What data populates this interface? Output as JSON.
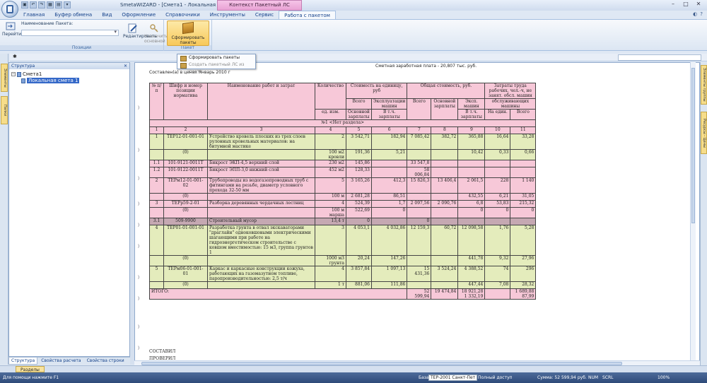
{
  "titlebar": {
    "title": "SmetaWIZARD - [Смета1 - Локальная смета 1]",
    "context_tab": "Контекст Пакетный ЛС",
    "qat": [
      "▣",
      "↶",
      "↷",
      "▦",
      "▤",
      "▾"
    ]
  },
  "tabs": [
    "Главная",
    "Буфер обмена",
    "Вид",
    "Оформление",
    "Справочники",
    "Инструменты",
    "Сервис",
    "Работа с пакетом"
  ],
  "ribbon": {
    "group_positions": "Позиции",
    "group_batch": "Пакет",
    "batch_name_label": "Наименование Пакета:",
    "goto": "Перейти",
    "edit": "Редактировать",
    "assign_main": "Назначить основной",
    "form_packages": "Сформировать пакеты"
  },
  "dropdown": {
    "item1": "Сформировать пакеты",
    "item2": "Создать пакетный ЛС из сметы"
  },
  "panel": {
    "header": "Структура",
    "tree_root": "Смета1",
    "tree_child": "Локальная смета 1",
    "tabs": [
      "Структура",
      "Свойства расчета",
      "Свойства строки"
    ]
  },
  "left_strip": [
    "Элементы",
    "Папки"
  ],
  "right_strip": [
    "Элементы группы",
    "Ресурсы - Цены"
  ],
  "doc": {
    "top_right": "Сметная заработная плата -           20,807 тыс. руб.",
    "top_left": "Составлен(а) в ценах Январь 2010 г",
    "headers": {
      "num": "№ п/п",
      "code": "Шифр и номер позиции норматива",
      "name": "Наименование работ и затрат",
      "qty": "Количество",
      "unit": "ед. изм.",
      "unit_cost": "Стоимость на единицу, руб",
      "total_cost": "Общая стоимость, руб.",
      "labor": "Затраты труда рабочих, чел.-ч, не занят. обсл. машин",
      "total": "Всего",
      "machines": "Эксплуатации машин",
      "base_salary": "Основной зарплаты",
      "incl_salary": "В т.ч. зарплаты",
      "mach": "Эксп. машин",
      "incl": "В т.ч. зарплаты",
      "serving": "обслуживающих машины",
      "per_unit": "На един.",
      "all": "Всего"
    },
    "section": "№1 <Нет раздела>",
    "colnums": [
      "1",
      "2",
      "3",
      "4",
      "5",
      "6",
      "7",
      "8",
      "9",
      "10",
      "11"
    ],
    "rows": [
      {
        "n": "1",
        "code": "ТЕР12-01-001-01",
        "name": "Устройство кровель плоских из трех слоев рулонных кровельных материалов: на битумной мастике",
        "q": "2",
        "u1": "3 542,71",
        "u2": "182,94",
        "t1": "7 085,42",
        "t2": "382,72",
        "t3": "365,88",
        "l1": "16,64",
        "l2": "33,28",
        "cls": "gr"
      },
      {
        "n": "",
        "code": "(0)",
        "name": "",
        "q": "100 м2 кровли",
        "u1": "191,36",
        "u2": "5,21",
        "t1": "",
        "t2": "",
        "t3": "10,42",
        "l1": "0,33",
        "l2": "0,66",
        "cls": "gr"
      },
      {
        "n": "1.1",
        "code": "101-9121-0011Т",
        "name": "Бикрост ЭКП-4,5 верхний слой",
        "q": "230 м2",
        "u1": "145,86",
        "u2": "",
        "t1": "33 547,8",
        "t2": "",
        "t3": "",
        "l1": "",
        "l2": "",
        "cls": "pk"
      },
      {
        "n": "1.2",
        "code": "101-9122-0011Т",
        "name": "Бикрост ЭПП-3,0 нижний слой",
        "q": "452 м2",
        "u1": "128,33",
        "u2": "",
        "t1": "58 006,84",
        "t2": "",
        "t3": "",
        "l1": "",
        "l2": "",
        "cls": "pk"
      },
      {
        "n": "2",
        "code": "ТЕРм12-01-001-02",
        "name": "Трубопроводы из водогазопроводных труб с фитингами на резьбе, диаметр условного прохода 32-50 мм",
        "q": "5",
        "u1": "3 165,26",
        "u2": "412,3",
        "t1": "15 826,3",
        "t2": "13 406,4",
        "t3": "2 061,5",
        "l1": "228",
        "l2": "1 140",
        "cls": "pk"
      },
      {
        "n": "",
        "code": "(0)",
        "name": "",
        "q": "100 м",
        "u1": "2 681,28",
        "u2": "86,51",
        "t1": "",
        "t2": "",
        "t3": "432,55",
        "l1": "6,21",
        "l2": "31,05",
        "cls": "pk"
      },
      {
        "n": "3",
        "code": "ТЕРр59-2-01",
        "name": "Разборка деревянных чердачных лестниц",
        "q": "4",
        "u1": "524,39",
        "u2": "1,7",
        "t1": "2 097,56",
        "t2": "2 090,76",
        "t3": "6,8",
        "l1": "53,83",
        "l2": "215,32",
        "cls": "pk"
      },
      {
        "n": "",
        "code": "(0)",
        "name": "",
        "q": "100 м марша",
        "u1": "522,69",
        "u2": "0",
        "t1": "",
        "t2": "",
        "t3": "0",
        "l1": "0",
        "l2": "0",
        "cls": "pk"
      },
      {
        "n": "3.1",
        "code": "509-9900",
        "name": "Строительный мусор",
        "q": "13,4 т",
        "u1": "0",
        "u2": "",
        "t1": "0",
        "t2": "",
        "t3": "",
        "l1": "",
        "l2": "",
        "cls": "gy"
      },
      {
        "n": "4",
        "code": "ТЕР01-01-001-01",
        "name": "Разработка грунта в отвал экскаваторами \"драглайн\" одноковшовыми электрическими шагающими при работе на гидроэнергетическом строительстве с ковшом вместимостью: 15 м3, группа грунтов 1",
        "q": "3",
        "u1": "4 053,1",
        "u2": "4 032,86",
        "t1": "12 159,3",
        "t2": "60,72",
        "t3": "12 098,58",
        "l1": "1,76",
        "l2": "5,28",
        "cls": "gr"
      },
      {
        "n": "",
        "code": "(0)",
        "name": "",
        "q": "1000 м3 грунта",
        "u1": "20,24",
        "u2": "147,26",
        "t1": "",
        "t2": "",
        "t3": "441,78",
        "l1": "9,32",
        "l2": "27,96",
        "cls": "gr"
      },
      {
        "n": "5",
        "code": "ТЕРм06-01-001-01",
        "name": "Каркас и каркасные конструкции кожуха, работающих на газомазутном топливе, паропроизводительностью: 2,5 т/ч",
        "q": "4",
        "u1": "3 857,84",
        "u2": "1 097,13",
        "t1": "15 431,36",
        "t2": "3 524,24",
        "t3": "4 388,52",
        "l1": "74",
        "l2": "296",
        "cls": "gr"
      },
      {
        "n": "",
        "code": "(0)",
        "name": "",
        "q": "1 т",
        "u1": "881,06",
        "u2": "111,86",
        "t1": "",
        "t2": "",
        "t3": "447,44",
        "l1": "7,08",
        "l2": "28,32",
        "cls": "gr"
      }
    ],
    "total_label": "ИТОГО:",
    "total": {
      "t1": "52 599,94",
      "t2": "19 474,84",
      "t3": "18 921,28",
      "t3b": "1 332,19",
      "l2": "1 689,88",
      "l2b": "87,99"
    },
    "composed": "СОСТАВИЛ",
    "checked": "ПРОВЕРИЛ"
  },
  "sheet_tab": "Разделы",
  "status": {
    "help": "Для помощи нажмите F1",
    "base_label": "База:",
    "base": "ТЕР-2001 Санкт-Пет",
    "access": "Полный доступ",
    "sum": "Сумма: 52 599,94 руб.",
    "num": "NUM",
    "scrl": "SCRL",
    "zoom": "100%"
  }
}
